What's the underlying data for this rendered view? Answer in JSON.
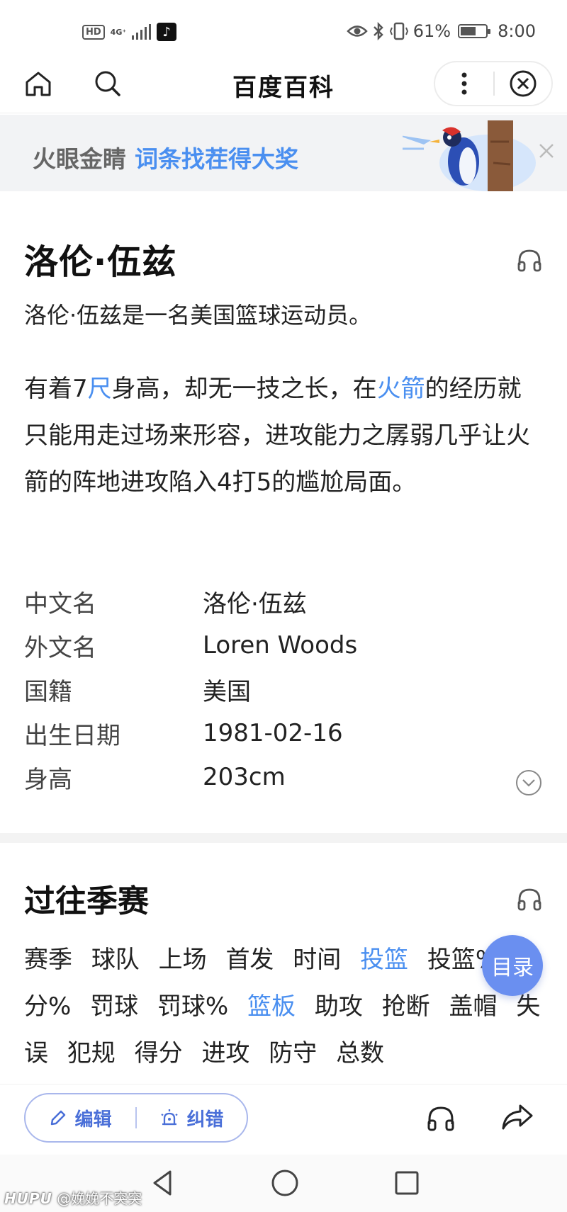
{
  "status_bar": {
    "hd": "HD",
    "network": "4G⁺",
    "battery": "61%",
    "time": "8:00",
    "battery_level": 0.61
  },
  "nav": {
    "title": "百度百科"
  },
  "banner": {
    "text_gray": "火眼金睛",
    "text_blue": "词条找茬得大奖"
  },
  "article": {
    "title": "洛伦·伍兹",
    "lead": "洛伦·伍兹是一名美国篮球运动员。",
    "para_parts": {
      "p1": "有着7",
      "link1": "尺",
      "p2": "身高，却无一技之长，在",
      "link2": "火箭",
      "p3": "的经历就只能用走过场来形容，进攻能力之孱弱几乎让火箭的阵地进攻陷入4打5的尴尬局面。"
    },
    "infobox": [
      {
        "label": "中文名",
        "value": "洛伦·伍兹"
      },
      {
        "label": "外文名",
        "value": "Loren Woods"
      },
      {
        "label": "国籍",
        "value": "美国"
      },
      {
        "label": "出生日期",
        "value": "1981-02-16"
      },
      {
        "label": "身高",
        "value": "203cm"
      }
    ]
  },
  "section": {
    "title": "过往季赛",
    "fields": [
      {
        "text": "赛季",
        "link": false
      },
      {
        "text": "球队",
        "link": false
      },
      {
        "text": "上场",
        "link": false
      },
      {
        "text": "首发",
        "link": false
      },
      {
        "text": "时间",
        "link": false
      },
      {
        "text": "投篮",
        "link": true
      },
      {
        "text": "投篮%",
        "link": false
      },
      {
        "text": "3分%",
        "link": false
      },
      {
        "text": "罚球",
        "link": false
      },
      {
        "text": "罚球%",
        "link": false
      },
      {
        "text": "篮板",
        "link": true
      },
      {
        "text": "助攻",
        "link": false
      },
      {
        "text": "抢断",
        "link": false
      },
      {
        "text": "盖帽",
        "link": false
      },
      {
        "text": "失误",
        "link": false
      },
      {
        "text": "犯规",
        "link": false
      },
      {
        "text": "得分",
        "link": false
      },
      {
        "text": "进攻",
        "link": false
      },
      {
        "text": "防守",
        "link": false
      },
      {
        "text": "总数",
        "link": false
      }
    ],
    "toc_label": "目录"
  },
  "toolbar": {
    "edit_label": "编辑",
    "fix_label": "纠错"
  },
  "watermark": {
    "brand": "HUPU",
    "user": "@娩娩不突突"
  },
  "colors": {
    "accent": "#4a8ff0",
    "toc": "#6a8ff0",
    "pill_text": "#4a6fd8",
    "banner_bg": "#f2f3f5"
  }
}
